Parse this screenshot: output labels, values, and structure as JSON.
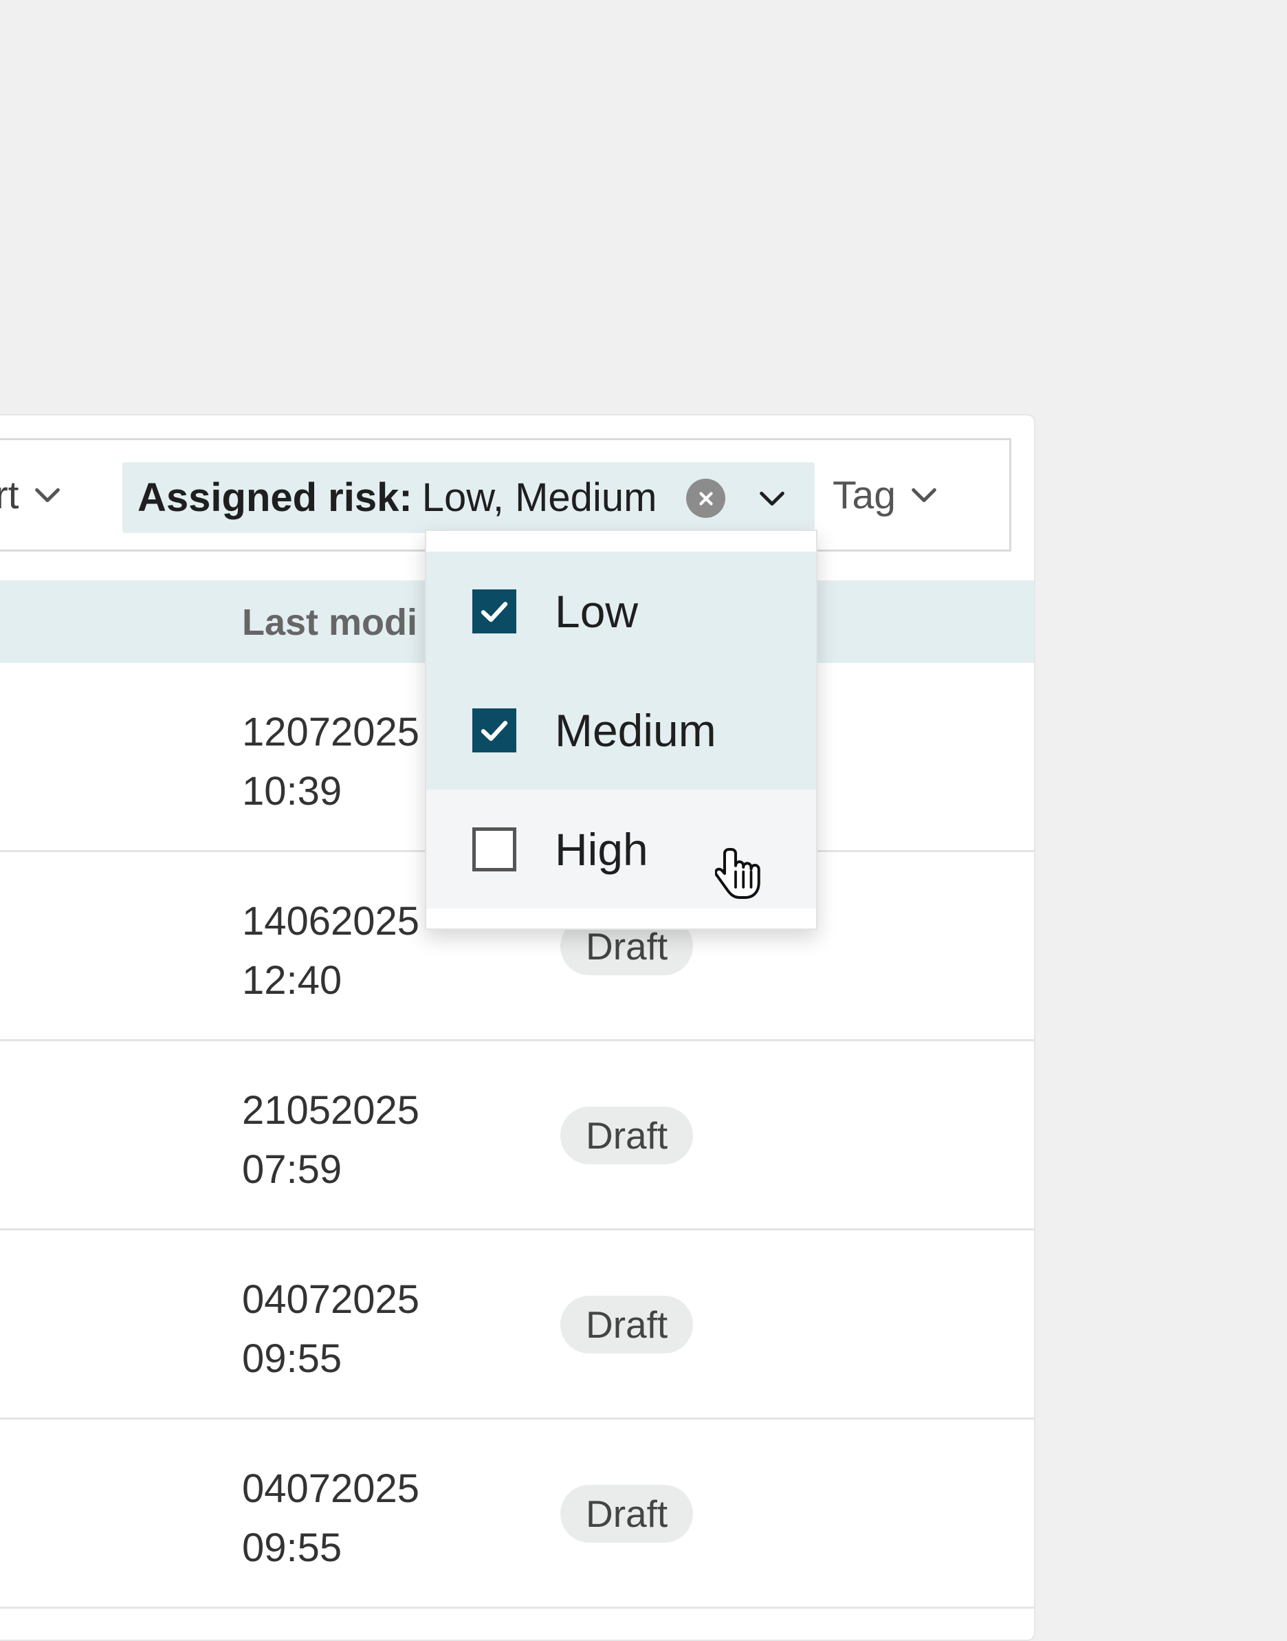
{
  "filters": {
    "expert_partial": "ert",
    "risk": {
      "label": "Assigned risk:",
      "value": "Low, Medium"
    },
    "tag": "Tag"
  },
  "table": {
    "header_last_modified_partial": "Last modi",
    "rows": [
      {
        "date": "12072025",
        "time": "10:39",
        "status": ""
      },
      {
        "date": "14062025",
        "time": "12:40",
        "status": "Draft"
      },
      {
        "date": "21052025",
        "time": "07:59",
        "status": "Draft"
      },
      {
        "date": "04072025",
        "time": "09:55",
        "status": "Draft"
      },
      {
        "date": "04072025",
        "time": "09:55",
        "status": "Draft"
      }
    ]
  },
  "dropdown": {
    "options": [
      {
        "label": "Low",
        "checked": true
      },
      {
        "label": "Medium",
        "checked": true
      },
      {
        "label": "High",
        "checked": false
      }
    ]
  },
  "colors": {
    "accent": "#0b4b63",
    "selected_bg": "#e3eef0",
    "page_bg": "#f0f0f0"
  }
}
